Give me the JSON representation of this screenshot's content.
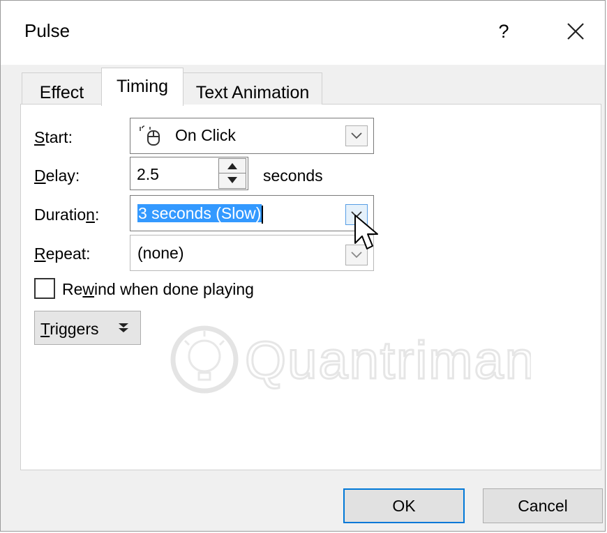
{
  "dialog": {
    "title": "Pulse",
    "help_label": "?",
    "close_icon": "close-icon"
  },
  "tabs": [
    {
      "label": "Effect",
      "active": false
    },
    {
      "label": "Timing",
      "active": true
    },
    {
      "label": "Text Animation",
      "active": false
    }
  ],
  "timing": {
    "start": {
      "label_prefix": "",
      "label_access": "S",
      "label_rest": "tart:",
      "value": "On Click",
      "icon": "mouse-click-icon"
    },
    "delay": {
      "label_access": "D",
      "label_rest": "elay:",
      "value": "2.5",
      "unit": "seconds"
    },
    "duration": {
      "label_before": "Duratio",
      "label_access": "n",
      "label_after": ":",
      "value": "3 seconds (Slow)"
    },
    "repeat": {
      "label_access": "R",
      "label_rest": "epeat:",
      "value": "(none)"
    },
    "rewind": {
      "label_before": "Re",
      "label_access": "w",
      "label_after": "ind when done playing",
      "checked": false
    },
    "triggers": {
      "label_access": "T",
      "label_rest": "riggers",
      "icon": "double-chevron-down-icon"
    }
  },
  "watermark_text": "Quantrimang",
  "buttons": {
    "ok": "OK",
    "cancel": "Cancel"
  },
  "colors": {
    "selection": "#3399ff",
    "default_button_border": "#0078d7",
    "dialog_bg": "#f0f0f0"
  }
}
